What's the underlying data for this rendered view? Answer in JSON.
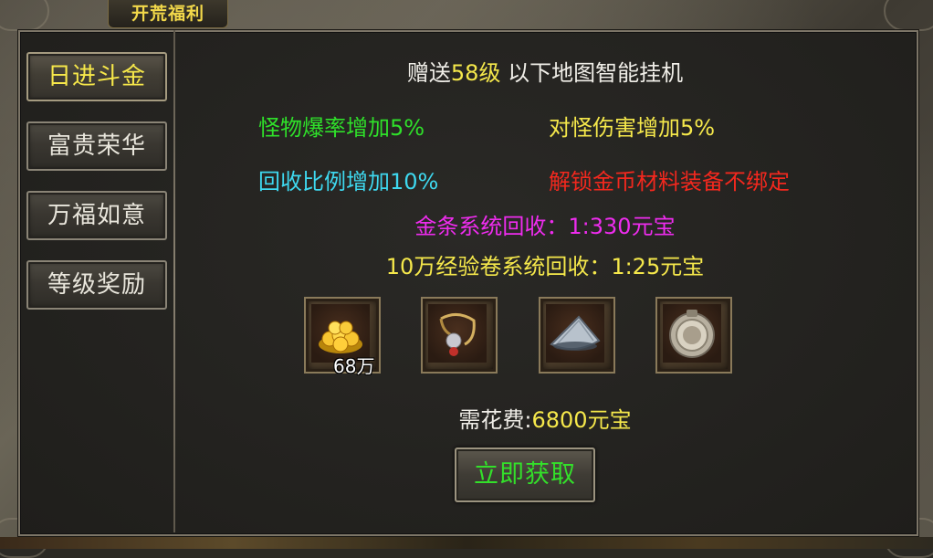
{
  "header": {
    "title": "开荒福利"
  },
  "tabs": [
    {
      "label": "日进斗金",
      "active": true
    },
    {
      "label": "富贵荣华",
      "active": false
    },
    {
      "label": "万福如意",
      "active": false
    },
    {
      "label": "等级奖励",
      "active": false
    }
  ],
  "content": {
    "gift_line": {
      "prefix": "赠送",
      "level": "58级",
      "suffix": " 以下地图智能挂机"
    },
    "bonus_drop": "怪物爆率增加5%",
    "bonus_damage": "对怪伤害增加5%",
    "bonus_recycle": "回收比例增加10%",
    "unlock_bind": "解锁金币材料装备不绑定",
    "gold_bar_recycle": "金条系统回收：1:330元宝",
    "exp_scroll_recycle": "10万经验卷系统回收：1:25元宝",
    "cost": {
      "label": "需花费:",
      "value": "6800元宝"
    },
    "claim_button": "立即获取"
  },
  "rewards": [
    {
      "icon": "gold-coins-icon",
      "count": "68万"
    },
    {
      "icon": "necklace-icon",
      "count": ""
    },
    {
      "icon": "bamboo-hat-icon",
      "count": ""
    },
    {
      "icon": "medal-icon",
      "count": ""
    }
  ],
  "colors": {
    "accent_yellow": "#f5e84b",
    "green": "#2fe02a",
    "cyan": "#3ed8ef",
    "red": "#f2281e",
    "magenta": "#ee2cee"
  }
}
